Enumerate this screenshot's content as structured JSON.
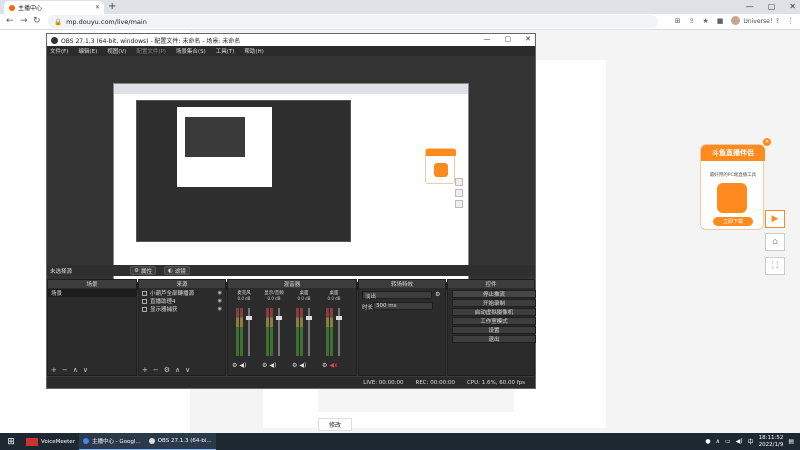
{
  "browser": {
    "tab_title": "主播中心",
    "url": "mp.douyu.com/live/main",
    "profile_name": "Universe！?"
  },
  "page": {
    "modify_label": "修改"
  },
  "promo": {
    "title": "斗鱼直播伴侣",
    "subtitle": "最好用的PC端直播工具",
    "download_label": "立即下载"
  },
  "obs": {
    "title": "OBS 27.1.3 (64-bit, windows) - 配置文件: 未命名 - 场景: 未命名",
    "menu": [
      "文件(F)",
      "编辑(E)",
      "视图(V)",
      "配置文件(P)",
      "场景集合(S)",
      "工具(T)",
      "帮助(H)"
    ],
    "no_source": "未选择源",
    "properties_label": "属性",
    "filters_label": "滤镜",
    "docks": {
      "scenes": "场景",
      "sources": "来源",
      "mixer": "混音器",
      "transitions": "转场特效",
      "controls": "控件"
    },
    "scene_item": "场景",
    "source_items": [
      "小葫芦全部轉播源",
      "直播助理4",
      "显示器捕获"
    ],
    "mixer_channels": [
      {
        "name": "麦克风",
        "db": "0.0 dB"
      },
      {
        "name": "显示/音频",
        "db": "0.0 dB"
      },
      {
        "name": "桌面",
        "db": "0.0 dB"
      },
      {
        "name": "桌面",
        "db": "0.0 dB"
      }
    ],
    "transition_type": "淡出",
    "duration_label": "时长",
    "duration_value": "300 ms",
    "controls": [
      "停止推流",
      "开始录制",
      "启动虚拟摄像机",
      "工作室模式",
      "设置",
      "退出"
    ],
    "status": {
      "live": "LIVE: 00:00:00",
      "rec": "REC: 00:00:00",
      "cpu": "CPU: 1.6%, 60.00 fps"
    }
  },
  "taskbar": {
    "apps": [
      "VoiceMeeter",
      "主播中心 - Googl...",
      "OBS 27.1.3 (64-bi..."
    ],
    "time": "18:11:52",
    "date": "2022/1/9"
  }
}
